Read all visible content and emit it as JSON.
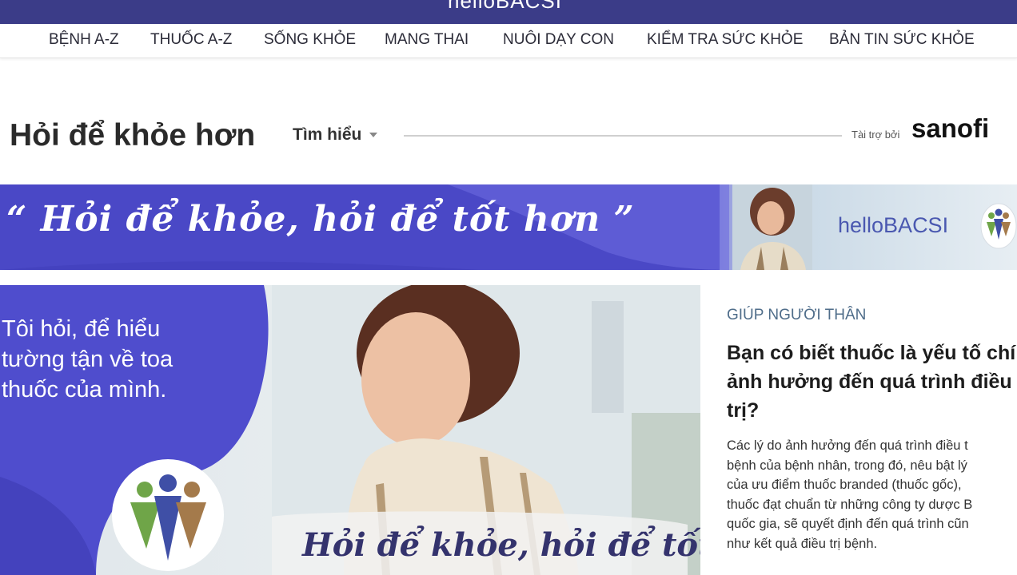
{
  "brand": {
    "logo_text": "helloBACSI"
  },
  "nav": {
    "items": [
      "BỆNH A-Z",
      "THUỐC A-Z",
      "SỐNG KHỎE",
      "MANG THAI",
      "NUÔI DẠY CON",
      "KIỂM TRA SỨC KHỎE",
      "BẢN TIN SỨC KHỎE"
    ]
  },
  "section": {
    "title": "Hỏi để khỏe hơn",
    "explore_label": "Tìm hiểu",
    "sponsor_label": "Tài trợ bởi",
    "sponsor_name": "sanofi"
  },
  "banner": {
    "slogan": "“ Hỏi để khỏe, hỏi để tốt hơn ”",
    "brand_text": "helloBACSI"
  },
  "hero": {
    "text_lines": [
      "Tôi hỏi, để hiểu",
      "tường tận về toa",
      "thuốc của mình."
    ],
    "slogan": "Hỏi để khỏe, hỏi để tốt hơn"
  },
  "article": {
    "category": "GIÚP NGƯỜI THÂN",
    "title_lines": [
      "Bạn có biết thuốc là yếu tố chí",
      "ảnh hưởng đến quá trình điều",
      "trị?"
    ],
    "summary_lines": [
      "Các lý do ảnh hưởng đến quá trình điều t",
      "bệnh của bệnh nhân, trong đó, nêu bật lý",
      "của ưu điểm thuốc branded (thuốc gốc),",
      "thuốc đạt chuẩn từ những công ty dược B",
      "quốc gia, sẽ quyết định đến quá trình cũn",
      "như kết quả điều trị bệnh."
    ]
  },
  "colors": {
    "brand_navy": "#3b3c88",
    "banner_purple": "#4b49c8",
    "category_blue": "#4f6d8a"
  }
}
